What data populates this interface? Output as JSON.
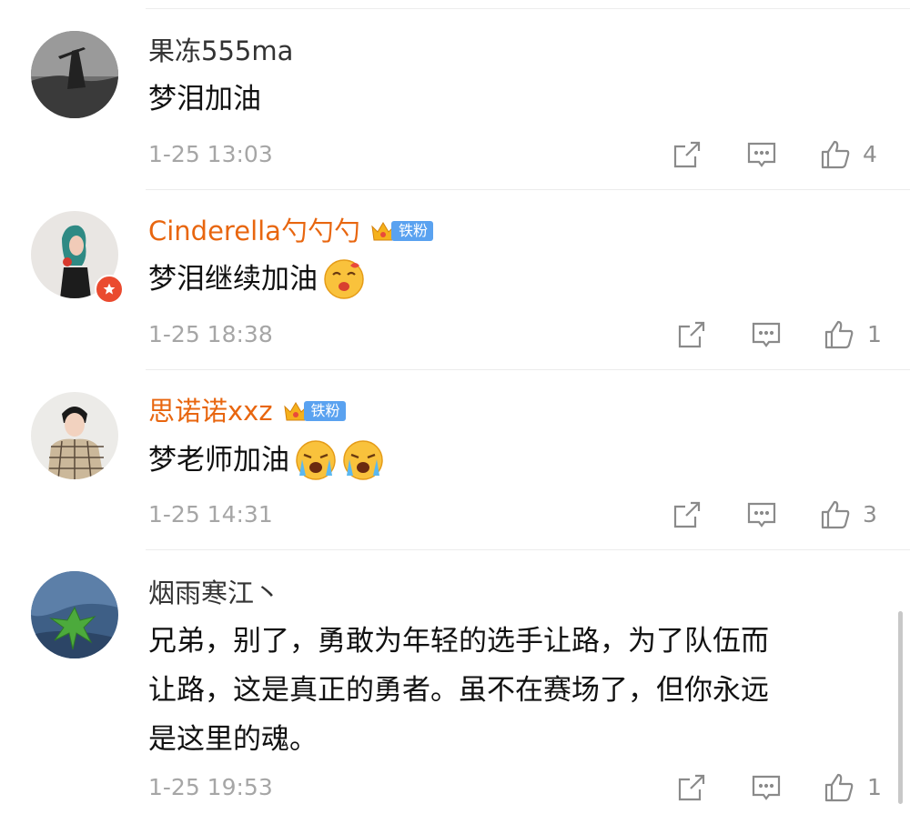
{
  "comments": [
    {
      "username": "果冻555ma",
      "text": "梦泪加油",
      "emoji_count": 0,
      "timestamp": "1-25 13:03",
      "likes": "4",
      "fan_badge": ""
    },
    {
      "username": "Cinderella勺勺勺",
      "text": "梦泪继续加油",
      "emoji_count": 1,
      "timestamp": "1-25 18:38",
      "likes": "1",
      "fan_badge": "铁粉"
    },
    {
      "username": "思诺诺xxz",
      "text": "梦老师加油",
      "emoji_count": 2,
      "timestamp": "1-25 14:31",
      "likes": "3",
      "fan_badge": "铁粉"
    },
    {
      "username": "烟雨寒江丶",
      "text_lines": [
        "兄弟，别了，勇敢为年轻的选手让路，为了队伍而",
        "让路，这是真正的勇者。虽不在赛场了，但你永远",
        "是这里的魂。"
      ],
      "emoji_count": 0,
      "timestamp": "1-25 19:53",
      "likes": "1",
      "fan_badge": ""
    }
  ],
  "icons": {
    "share": "share-icon",
    "reply": "comment-icon",
    "like": "thumbs-up-icon",
    "crown": "crown-icon",
    "vip": "star-badge-icon"
  },
  "colors": {
    "username_highlight": "#e8660f",
    "fan_badge": "#5aa2f0",
    "meta_text": "#a6a6a6",
    "vip_badge": "#ea4a2f"
  }
}
